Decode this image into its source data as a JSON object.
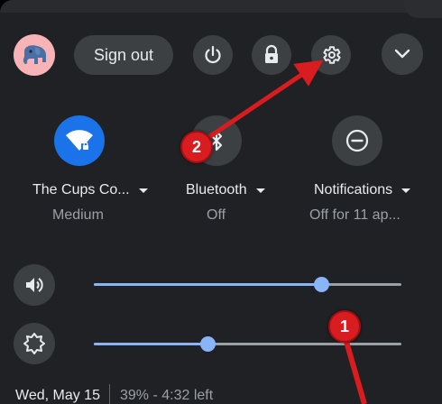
{
  "header": {
    "sign_out_label": "Sign out"
  },
  "tiles": [
    {
      "label": "The Cups Co...",
      "status": "Medium",
      "icon": "wifi-icon"
    },
    {
      "label": "Bluetooth",
      "status": "Off",
      "icon": "bluetooth-icon"
    },
    {
      "label": "Notifications",
      "status": "Off for 11 ap...",
      "icon": "do-not-disturb-icon"
    }
  ],
  "sliders": {
    "volume": {
      "icon": "volume-icon",
      "level": 0.74
    },
    "brightness": {
      "icon": "brightness-icon",
      "level": 0.37
    }
  },
  "footer": {
    "date": "Wed, May 15",
    "battery": "39% - 4:32 left"
  },
  "annotations": {
    "callout_1": "1",
    "callout_2": "2"
  },
  "colors": {
    "panel_bg": "#202124",
    "button_bg": "#3c4043",
    "accent_blue": "#8ab4f8",
    "wifi_active": "#1a73e8",
    "callout_red": "#d81c20"
  }
}
